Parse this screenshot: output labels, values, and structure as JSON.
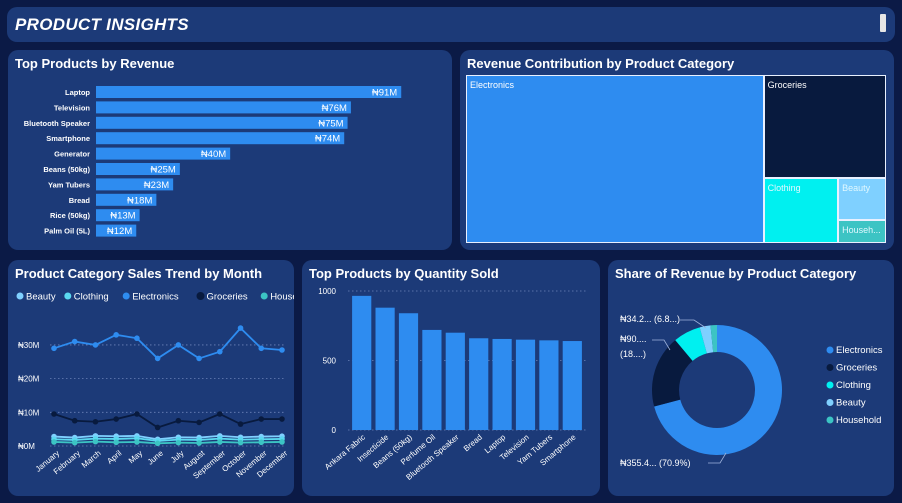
{
  "header": {
    "title": "PRODUCT INSIGHTS"
  },
  "colors": {
    "bg": "#0b1a46",
    "panel": "#1c3a78",
    "blue": "#2e8cf0",
    "navy": "#081a3e",
    "cyan": "#00f0f0",
    "lightblue": "#7fd0ff",
    "teal": "#3cc4c4"
  },
  "panels": {
    "revenue": {
      "title": "Top Products by Revenue"
    },
    "treemap": {
      "title": "Revenue Contribution by Product Category"
    },
    "trend": {
      "title": "Product Category Sales Trend by Month"
    },
    "quantity": {
      "title": "Top Products by Quantity Sold"
    },
    "share": {
      "title": "Share of Revenue by Product Category"
    }
  },
  "chart_data": [
    {
      "id": "revenue",
      "type": "bar",
      "orientation": "horizontal",
      "title": "Top Products by Revenue",
      "categories": [
        "Laptop",
        "Television",
        "Bluetooth Speaker",
        "Smartphone",
        "Generator",
        "Beans (50kg)",
        "Yam Tubers",
        "Bread",
        "Rice (50kg)",
        "Palm Oil (5L)"
      ],
      "values": [
        91,
        76,
        75,
        74,
        40,
        25,
        23,
        18,
        13,
        12
      ],
      "labels": [
        "₦91M",
        "₦76M",
        "₦75M",
        "₦74M",
        "₦40M",
        "₦25M",
        "₦23M",
        "₦18M",
        "₦13M",
        "₦12M"
      ],
      "xlim": [
        0,
        120
      ]
    },
    {
      "id": "treemap",
      "type": "treemap",
      "title": "Revenue Contribution by Product Category",
      "items": [
        {
          "name": "Electronics",
          "value": 355.4,
          "color": "#2e8cf0"
        },
        {
          "name": "Groceries",
          "value": 90,
          "color": "#081a3e"
        },
        {
          "name": "Clothing",
          "value": 34.2,
          "color": "#00f0f0"
        },
        {
          "name": "Beauty",
          "value": 14,
          "color": "#7fd0ff"
        },
        {
          "name": "Househ...",
          "value": 8,
          "color": "#3cc4c4"
        }
      ]
    },
    {
      "id": "trend",
      "type": "line",
      "title": "Product Category Sales Trend by Month",
      "x": [
        "January",
        "February",
        "March",
        "April",
        "May",
        "June",
        "July",
        "August",
        "September",
        "October",
        "November",
        "December"
      ],
      "yticks": [
        "₦0M",
        "₦10M",
        "₦20M",
        "₦30M"
      ],
      "ylim": [
        0,
        38
      ],
      "grid": true,
      "legend": "top",
      "series": [
        {
          "name": "Beauty",
          "color": "#7fd0ff",
          "values": [
            2.8,
            2.5,
            3.0,
            2.9,
            3.0,
            2.0,
            2.6,
            2.5,
            3.0,
            2.6,
            2.8,
            2.9
          ]
        },
        {
          "name": "Clothing",
          "color": "#5ad8f0",
          "values": [
            2.0,
            1.8,
            2.2,
            2.1,
            2.3,
            1.5,
            1.9,
            1.8,
            2.2,
            1.9,
            2.0,
            2.1
          ]
        },
        {
          "name": "Electronics",
          "color": "#2e8cf0",
          "values": [
            29,
            31,
            30,
            33,
            32,
            26,
            30,
            26,
            28,
            35,
            29,
            28.5
          ]
        },
        {
          "name": "Groceries",
          "color": "#081a3e",
          "values": [
            9.5,
            7.5,
            7.2,
            8,
            9.5,
            5.5,
            7.5,
            7,
            9.5,
            6.5,
            8,
            8
          ]
        },
        {
          "name": "Household",
          "color": "#3cc4c4",
          "values": [
            1.2,
            1.0,
            1.3,
            1.1,
            1.2,
            0.8,
            1.0,
            0.9,
            1.2,
            1.0,
            1.1,
            1.2
          ]
        }
      ]
    },
    {
      "id": "quantity",
      "type": "bar",
      "title": "Top Products by Quantity Sold",
      "categories": [
        "Ankara Fabric",
        "Insecticide",
        "Beans (50kg)",
        "Perfume Oil",
        "Bluetooth Speaker",
        "Bread",
        "Laptop",
        "Television",
        "Yam Tubers",
        "Smartphone"
      ],
      "values": [
        965,
        880,
        840,
        720,
        700,
        660,
        655,
        650,
        645,
        640
      ],
      "yticks": [
        "0",
        "500",
        "1000"
      ],
      "ylim": [
        0,
        1000
      ],
      "grid": true
    },
    {
      "id": "share",
      "type": "pie",
      "title": "Share of Revenue by Product Category",
      "labels": [
        "Electronics",
        "Groceries",
        "Clothing",
        "Beauty",
        "Household"
      ],
      "values": [
        70.9,
        18.0,
        6.8,
        2.7,
        1.6
      ],
      "colors": [
        "#2e8cf0",
        "#081a3e",
        "#00f0f0",
        "#7fd0ff",
        "#3cc4c4"
      ],
      "data_labels": {
        "electronics": "₦355.4... (70.9%)",
        "groceries_1": "₦90....",
        "groceries_2": "(18....)",
        "clothing": "₦34.2... (6.8...)"
      },
      "legend": "right"
    }
  ]
}
